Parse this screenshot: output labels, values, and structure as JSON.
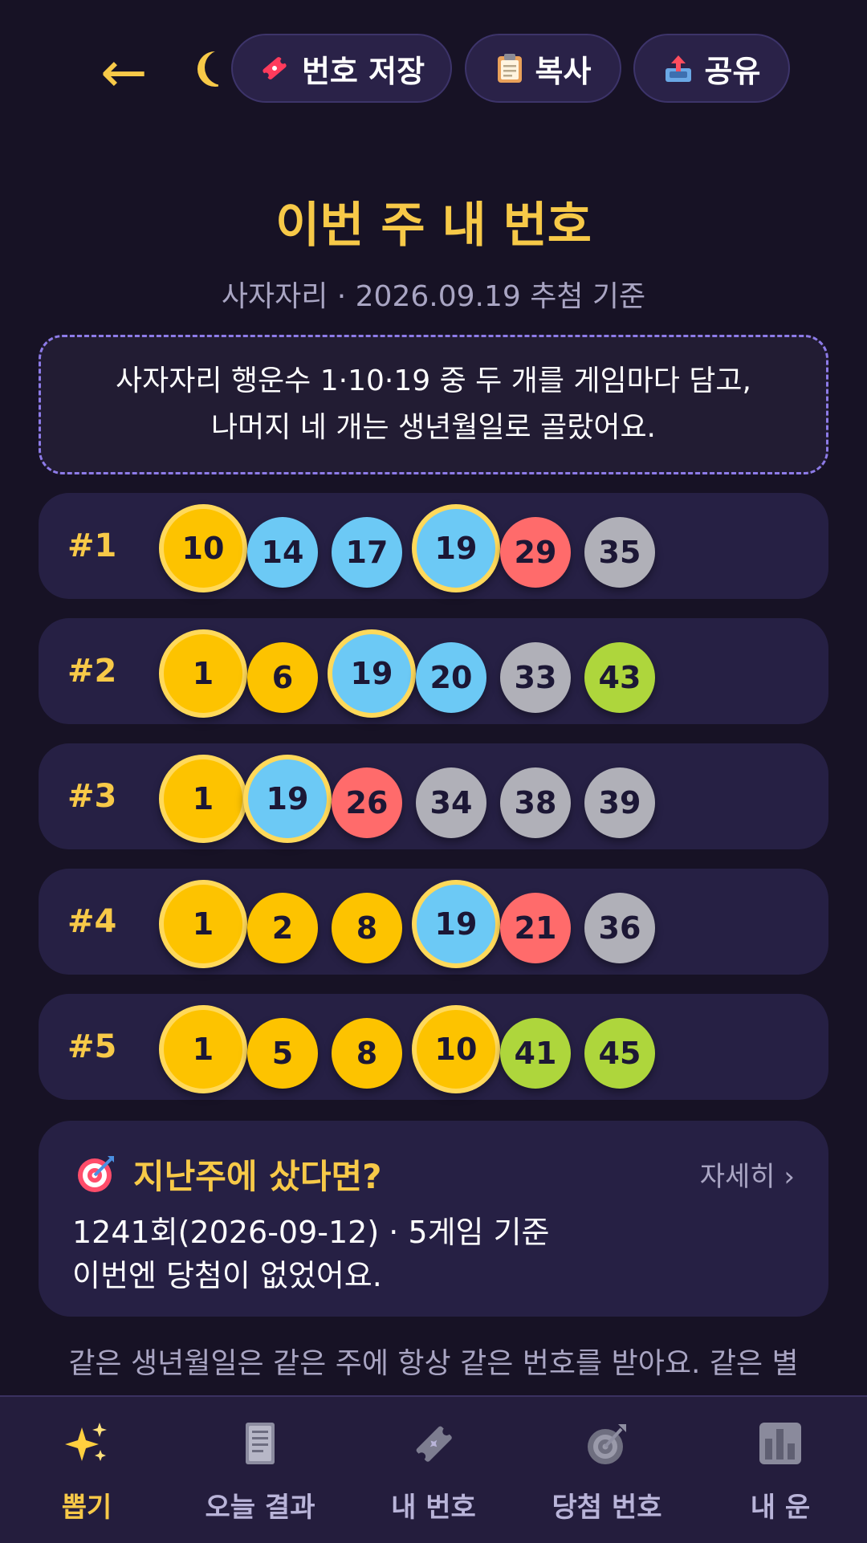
{
  "header": {
    "back_glyph": "←",
    "save_label": "번호 저장",
    "copy_label": "복사",
    "share_label": "공유"
  },
  "title": "이번 주 내 번호",
  "subtitle": "사자자리 · 2026.09.19 추첨 기준",
  "note": {
    "line1": "사자자리 행운수 1·10·19 중 두 개를 게임마다 담고,",
    "line2": "나머지 네 개는 생년월일로 골랐어요."
  },
  "games": [
    {
      "label": "#1",
      "numbers": [
        "10",
        "14",
        "17",
        "19",
        "29",
        "35"
      ]
    },
    {
      "label": "#2",
      "numbers": [
        "1",
        "6",
        "19",
        "20",
        "33",
        "43"
      ]
    },
    {
      "label": "#3",
      "numbers": [
        "1",
        "19",
        "26",
        "34",
        "38",
        "39"
      ]
    },
    {
      "label": "#4",
      "numbers": [
        "1",
        "2",
        "8",
        "19",
        "21",
        "36"
      ]
    },
    {
      "label": "#5",
      "numbers": [
        "1",
        "5",
        "8",
        "10",
        "41",
        "45"
      ]
    }
  ],
  "last_week": {
    "title": "지난주에 샀다면?",
    "more": "자세히 ›",
    "line1": "1241회(2026-09-12) · 5게임 기준",
    "line2": "이번엔 당첨이 없었어요."
  },
  "footnote": "같은 생년월일은 같은 주에 항상 같은 번호를 받아요. 같은 별",
  "nav": {
    "draw": "뽑기",
    "today": "오늘 결과",
    "mine": "내 번호",
    "winning": "당첨 번호",
    "fortune": "내 운"
  },
  "colors": {
    "accent": "#f7c948",
    "background": "#171225",
    "card": "#262044"
  }
}
